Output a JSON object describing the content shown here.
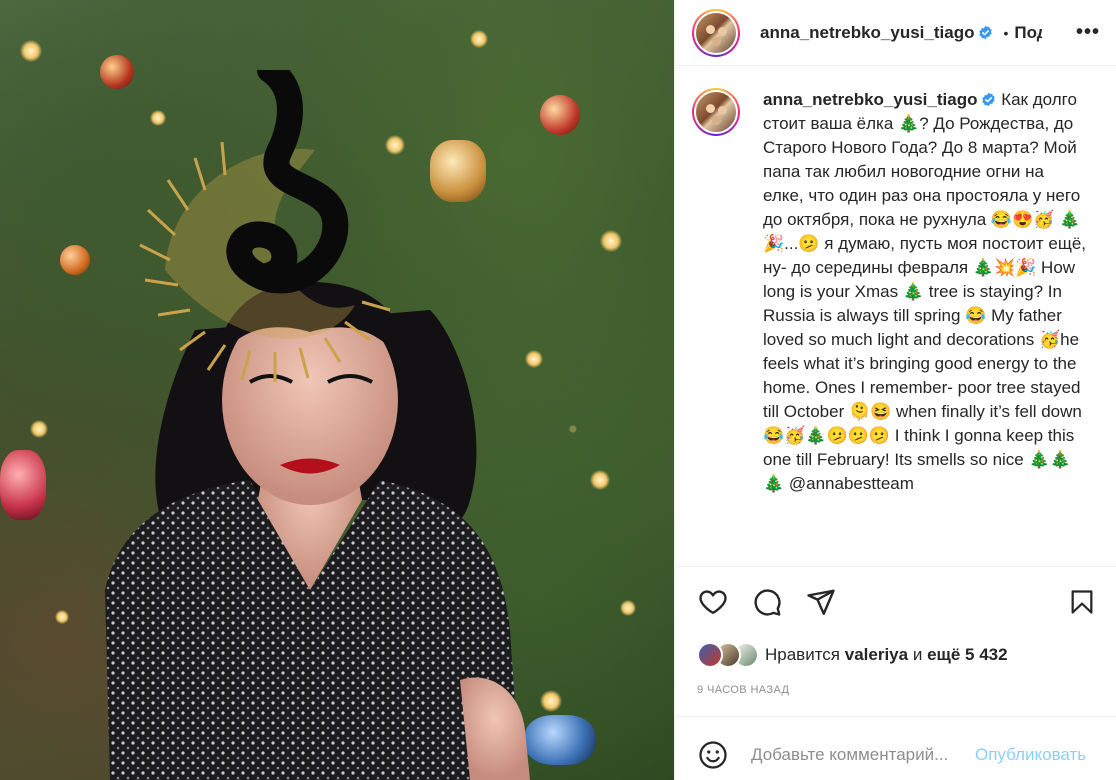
{
  "post": {
    "username": "anna_netrebko_yusi_tiago",
    "separator": "•",
    "follow_label": "Подписаться",
    "more_label": "•••"
  },
  "caption": {
    "username": "anna_netrebko_yusi_tiago",
    "text": "Как долго стоит ваша ёлка 🎄? До Рождества, до Старого Нового Года? До 8 марта? Мой папа так любил новогодние огни на елке, что один раз она простояла у него до октября, пока не рухнула 😂😍🥳 🎄🎉...🫤 я думаю, пусть моя постоит ещё, ну- до середины февраля 🎄💥🎉 How long is your Xmas 🎄 tree is staying? In Russia is always till spring 😂 My father loved so much light and decorations 🥳he feels what it’s bringing good energy to the home. Ones I remember- poor tree stayed till October 🫠😆 when finally it’s fell down 😂🥳🎄🫤🫤🫤 I think I gonna keep this one till February! Its smells so nice 🎄🎄🎄 @annabestteam"
  },
  "likes": {
    "prefix": "Нравится",
    "user": "valeriya",
    "middle": "и",
    "count": "ещё 5 432"
  },
  "timestamp": "9 часов назад",
  "comment": {
    "placeholder": "Добавьте комментарий...",
    "publish_label": "Опубликовать"
  },
  "colors": {
    "accent": "#0095f6",
    "text": "#262626",
    "secondary": "#8e8e8e",
    "border": "#efefef",
    "verified": "#3897f0"
  },
  "icons": [
    "heart-icon",
    "comment-icon",
    "share-icon",
    "bookmark-icon",
    "emoji-icon",
    "verified-icon",
    "more-icon"
  ]
}
